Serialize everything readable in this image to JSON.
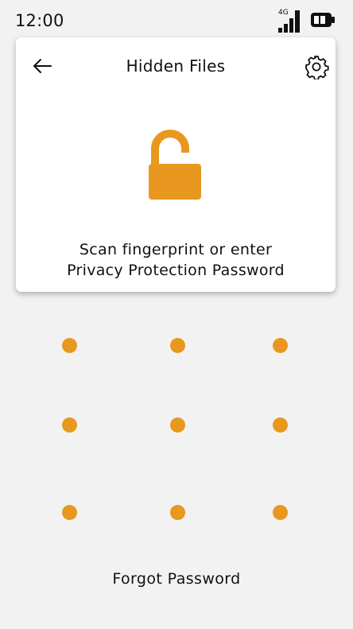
{
  "status_bar": {
    "time": "12:00",
    "network": "4G",
    "icons": [
      "signal-icon",
      "battery-icon"
    ]
  },
  "card": {
    "title": "Hidden Files",
    "icons": [
      "back-arrow-icon",
      "gear-icon",
      "unlocked-padlock-icon"
    ],
    "prompt_line1": "Scan fingerprint or enter",
    "prompt_line2": "Privacy Protection Password"
  },
  "pattern": {
    "dot_count": 9,
    "rows": 3,
    "columns": 3
  },
  "footer": {
    "forgot_label": "Forgot Password"
  },
  "colors": {
    "accent": "#e8981f",
    "background": "#f2f2f2",
    "card": "#ffffff",
    "text": "#111111"
  }
}
